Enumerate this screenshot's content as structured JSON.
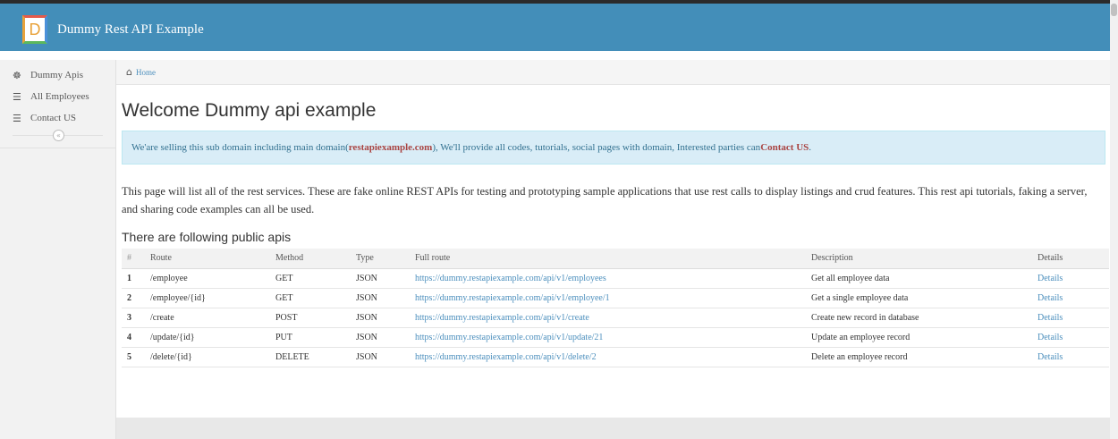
{
  "header": {
    "logo_letter": "D",
    "title": "Dummy Rest API Example"
  },
  "sidebar": {
    "items": [
      {
        "label": "Dummy Apis",
        "icon": "☸"
      },
      {
        "label": "All Employees",
        "icon": "☰"
      },
      {
        "label": "Contact US",
        "icon": "☰"
      }
    ],
    "collapse_icon": "«"
  },
  "breadcrumb": {
    "home_icon": "⌂",
    "home_label": "Home"
  },
  "main": {
    "title": "Welcome Dummy api example",
    "alert": {
      "prefix": "We'are selling this sub domain including main domain(",
      "domain": "restapiexample.com",
      "middle": "), We'll provide all codes, tutorials, social pages with domain, Interested parties can ",
      "contact": "Contact US",
      "suffix": "."
    },
    "intro": "This page will list all of the rest services. These are fake online REST APIs for testing and prototyping sample applications that use rest calls to display listings and crud features. This rest api tutorials, faking a server, and sharing code examples can all be used.",
    "subtitle": "There are following public apis",
    "table": {
      "headers": [
        "#",
        "Route",
        "Method",
        "Type",
        "Full route",
        "Description",
        "Details"
      ],
      "rows": [
        {
          "num": "1",
          "route": "/employee",
          "method": "GET",
          "type": "JSON",
          "full": "https://dummy.restapiexample.com/api/v1/employees",
          "desc": "Get all employee data",
          "details": "Details"
        },
        {
          "num": "2",
          "route": "/employee/{id}",
          "method": "GET",
          "type": "JSON",
          "full": "https://dummy.restapiexample.com/api/v1/employee/1",
          "desc": "Get a single employee data",
          "details": "Details"
        },
        {
          "num": "3",
          "route": "/create",
          "method": "POST",
          "type": "JSON",
          "full": "https://dummy.restapiexample.com/api/v1/create",
          "desc": "Create new record in database",
          "details": "Details"
        },
        {
          "num": "4",
          "route": "/update/{id}",
          "method": "PUT",
          "type": "JSON",
          "full": "https://dummy.restapiexample.com/api/v1/update/21",
          "desc": "Update an employee record",
          "details": "Details"
        },
        {
          "num": "5",
          "route": "/delete/{id}",
          "method": "DELETE",
          "type": "JSON",
          "full": "https://dummy.restapiexample.com/api/v1/delete/2",
          "desc": "Delete an employee record",
          "details": "Details"
        }
      ]
    }
  },
  "colors": {
    "header": "#438eb9",
    "link": "#4c8fbd",
    "alert_bg": "#d9edf7",
    "alert_highlight": "#a94442"
  }
}
